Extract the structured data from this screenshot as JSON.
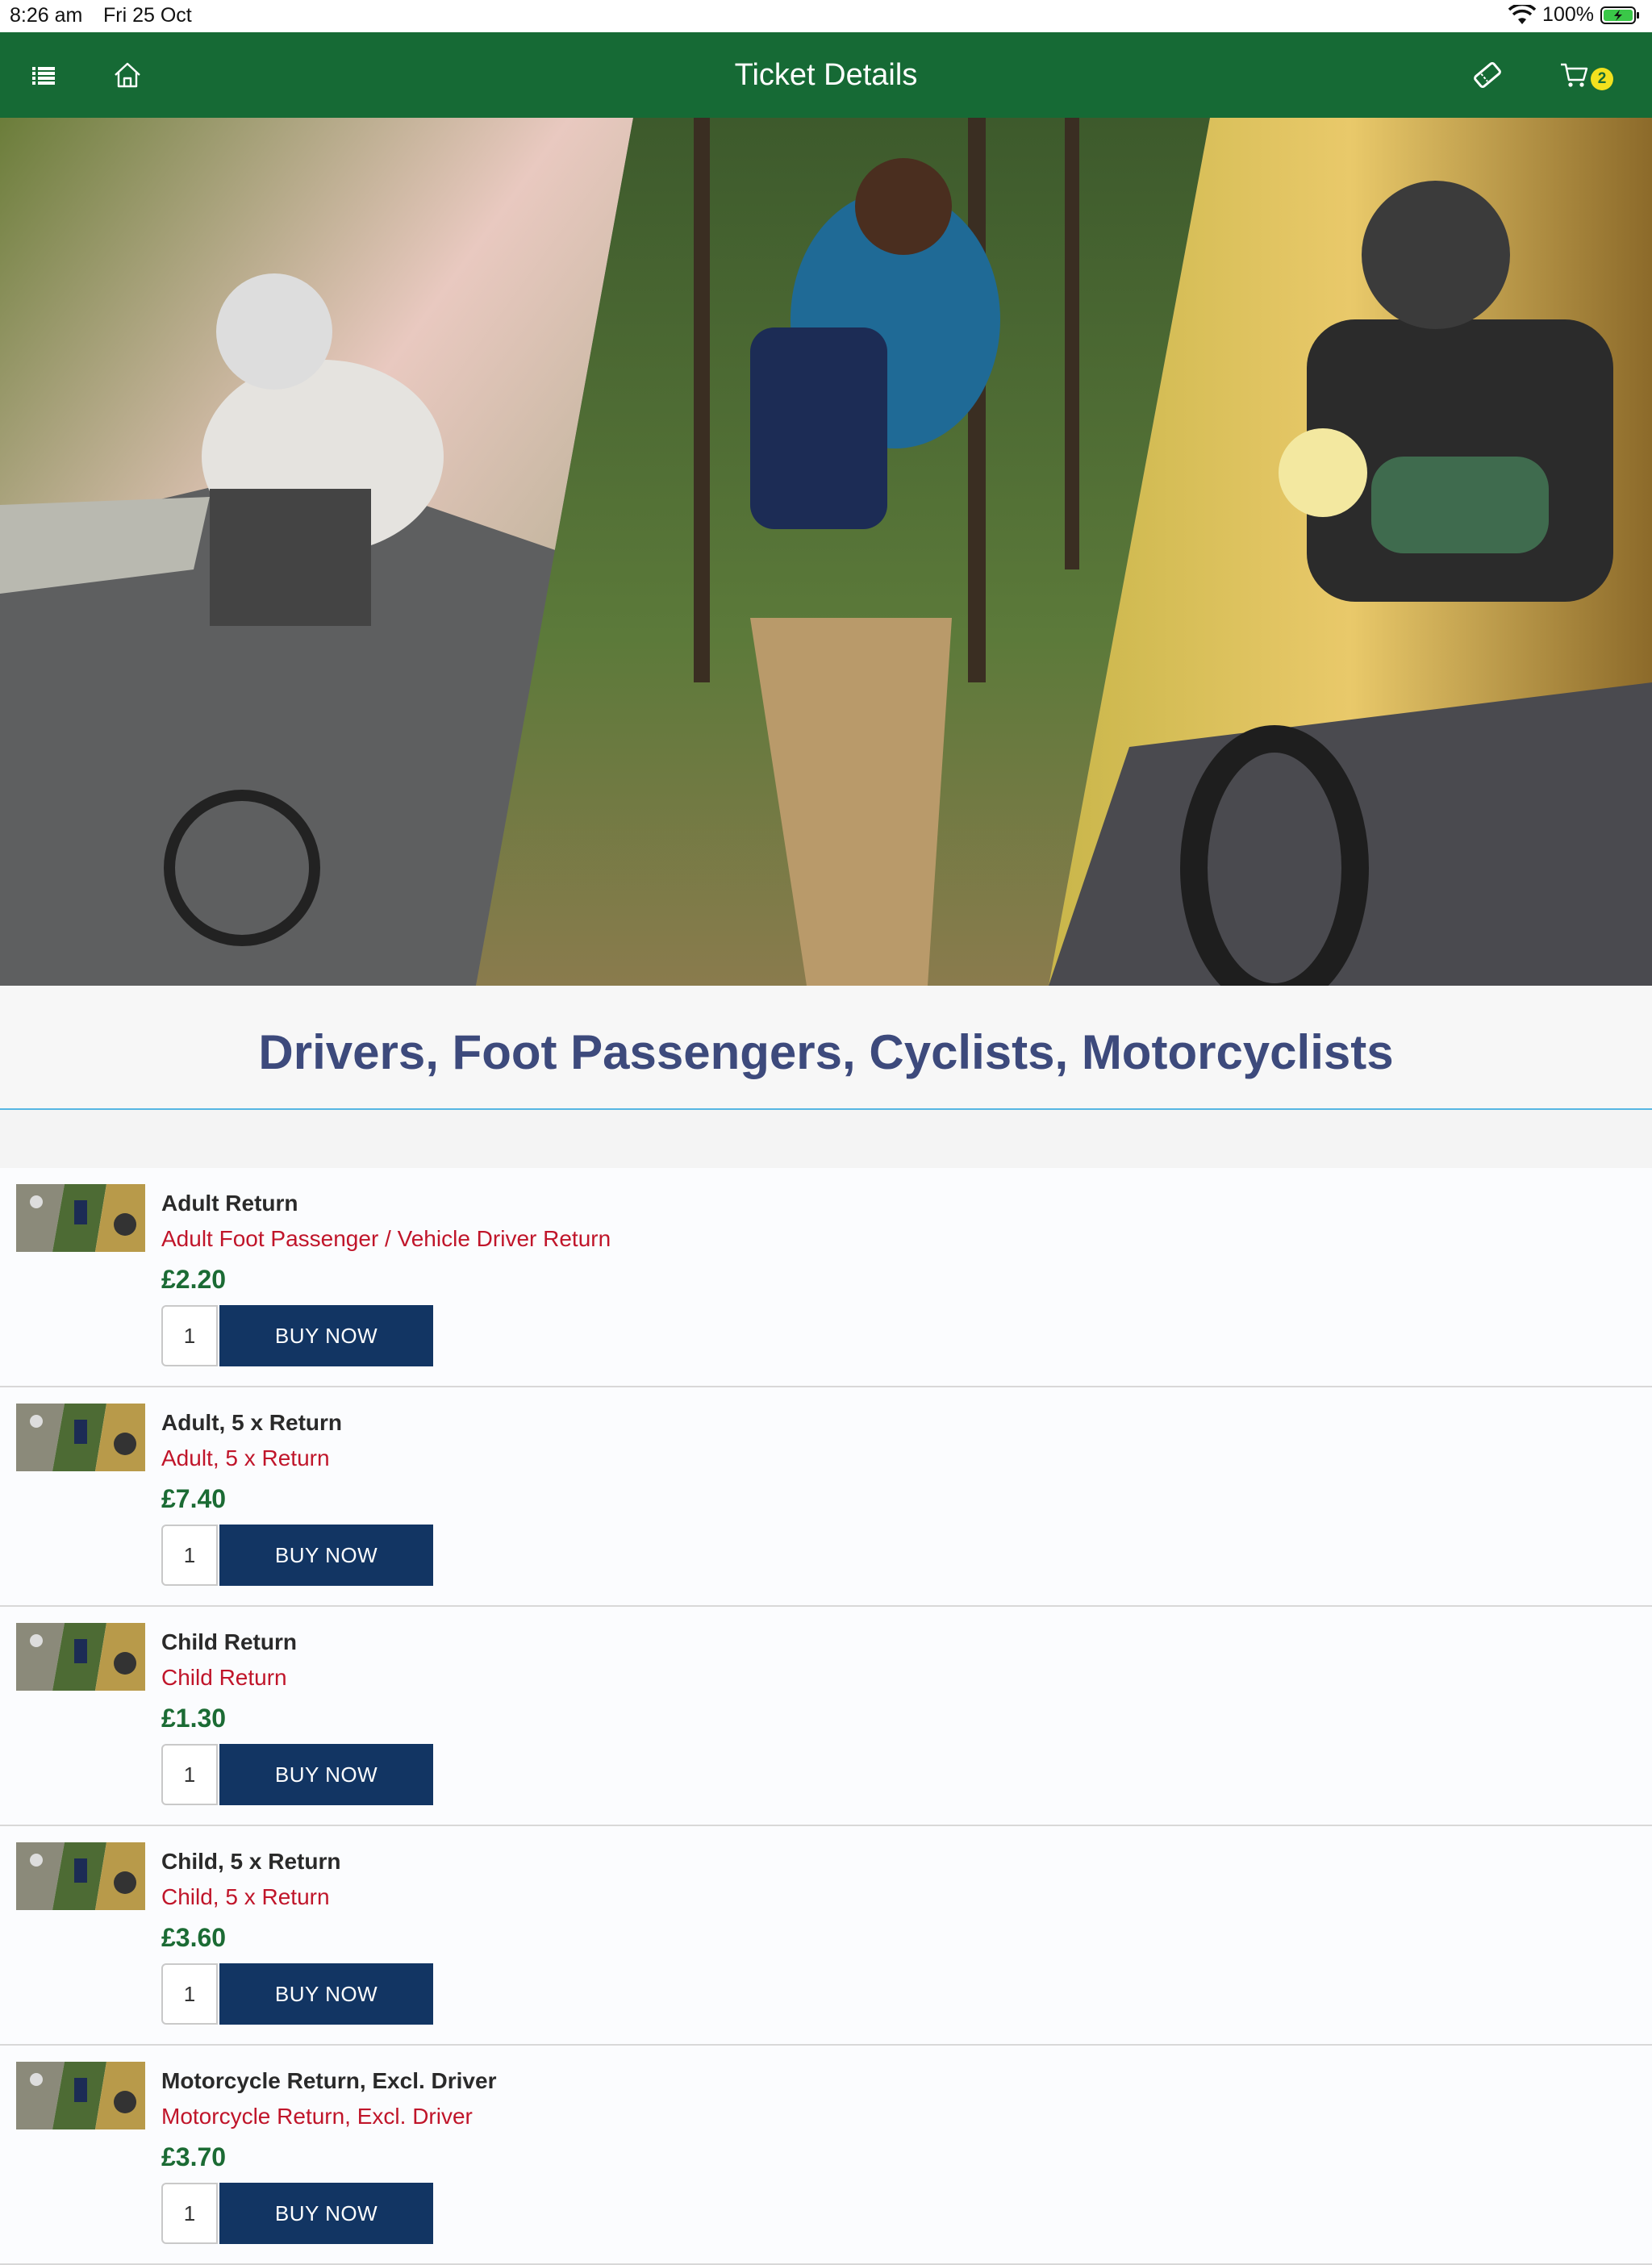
{
  "status_bar": {
    "time": "8:26 am",
    "date": "Fri 25 Oct",
    "battery": "100%"
  },
  "navbar": {
    "title": "Ticket Details",
    "menu_icon": "list-icon",
    "home_icon": "home-icon",
    "ticket_icon": "ticket-icon",
    "cart_icon": "cart-icon",
    "cart_count": "2",
    "color": "#166a35"
  },
  "hero": {
    "image": "cyclist, hiker and motorcyclist collage"
  },
  "section": {
    "title": "Drivers, Foot Passengers, Cyclists, Motorcyclists"
  },
  "tickets": [
    {
      "name": "Adult Return",
      "description": "Adult Foot Passenger / Vehicle Driver Return",
      "price": "£2.20",
      "quantity": "1",
      "button": "BUY NOW"
    },
    {
      "name": "Adult, 5 x Return",
      "description": "Adult, 5 x Return",
      "price": "£7.40",
      "quantity": "1",
      "button": "BUY NOW"
    },
    {
      "name": "Child Return",
      "description": "Child Return",
      "price": "£1.30",
      "quantity": "1",
      "button": "BUY NOW"
    },
    {
      "name": "Child, 5 x Return",
      "description": "Child, 5 x Return",
      "price": "£3.60",
      "quantity": "1",
      "button": "BUY NOW"
    },
    {
      "name": "Motorcycle Return, Excl. Driver",
      "description": "Motorcycle Return, Excl. Driver",
      "price": "£3.70",
      "quantity": "1",
      "button": "BUY NOW"
    }
  ],
  "colors": {
    "accent_green": "#166a35",
    "button_navy": "#123563",
    "description_red": "#c0152a",
    "heading_blue": "#3d4a7c",
    "badge_yellow": "#f2e11e"
  }
}
